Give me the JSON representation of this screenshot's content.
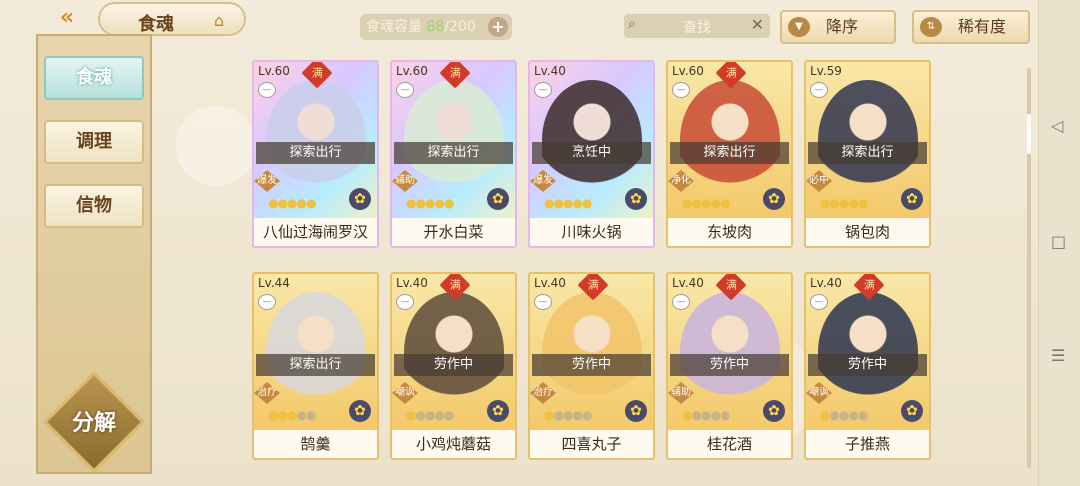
{
  "header": {
    "back_icon": "double-chevron-left-icon",
    "title": "食魂",
    "home_icon": "pavilion-icon",
    "capacity_label": "食魂容量",
    "capacity_current": "88",
    "capacity_max": "/200",
    "capacity_plus": "+",
    "search_label": "查找",
    "search_clear": "✕",
    "sort_label": "降序",
    "rarity_label": "稀有度"
  },
  "sidebar": {
    "tabs": [
      {
        "label": "食魂",
        "active": true
      },
      {
        "label": "调理",
        "active": false
      },
      {
        "label": "信物",
        "active": false
      }
    ],
    "decompose_label": "分解"
  },
  "cards": [
    {
      "level": "Lv.60",
      "full": "满",
      "status": "探索出行",
      "role": "爆发",
      "stars": 5,
      "name": "八仙过海闹罗汉",
      "rarity": "rainbow",
      "hue": "#c9cfe9"
    },
    {
      "level": "Lv.60",
      "full": "满",
      "status": "探索出行",
      "role": "辅助",
      "stars": 5,
      "name": "开水白菜",
      "rarity": "rainbow",
      "hue": "#d9ecd2"
    },
    {
      "level": "Lv.40",
      "full": "",
      "status": "烹饪中",
      "role": "爆发",
      "stars": 5,
      "name": "川味火锅",
      "rarity": "rainbow",
      "hue": "#3b2a2a"
    },
    {
      "level": "Lv.60",
      "full": "满",
      "status": "探索出行",
      "role": "净化",
      "stars": 5,
      "name": "东坡肉",
      "rarity": "gold",
      "hue": "#c84a36"
    },
    {
      "level": "Lv.59",
      "full": "",
      "status": "探索出行",
      "role": "必中",
      "stars": 5,
      "name": "锅包肉",
      "rarity": "gold",
      "hue": "#2f3550"
    },
    {
      "level": "Lv.44",
      "full": "",
      "status": "探索出行",
      "role": "治疗",
      "stars": 3,
      "name": "鹄羹",
      "rarity": "gold",
      "hue": "#d7d7de"
    },
    {
      "level": "Lv.40",
      "full": "满",
      "status": "劳作中",
      "role": "嘲讽",
      "stars": 1,
      "name": "小鸡炖蘑菇",
      "rarity": "gold",
      "hue": "#5b4a3a"
    },
    {
      "level": "Lv.40",
      "full": "满",
      "status": "劳作中",
      "role": "治疗",
      "stars": 1,
      "name": "四喜丸子",
      "rarity": "gold",
      "hue": "#f2c46a"
    },
    {
      "level": "Lv.40",
      "full": "满",
      "status": "劳作中",
      "role": "辅助",
      "stars": 1,
      "name": "桂花酒",
      "rarity": "gold",
      "hue": "#c8b3e0"
    },
    {
      "level": "Lv.40",
      "full": "满",
      "status": "劳作中",
      "role": "嘲讽",
      "stars": 1,
      "name": "子推燕",
      "rarity": "gold",
      "hue": "#2a3450"
    }
  ],
  "system_nav": {
    "back": "◁",
    "home": "□",
    "menu": "☰"
  }
}
